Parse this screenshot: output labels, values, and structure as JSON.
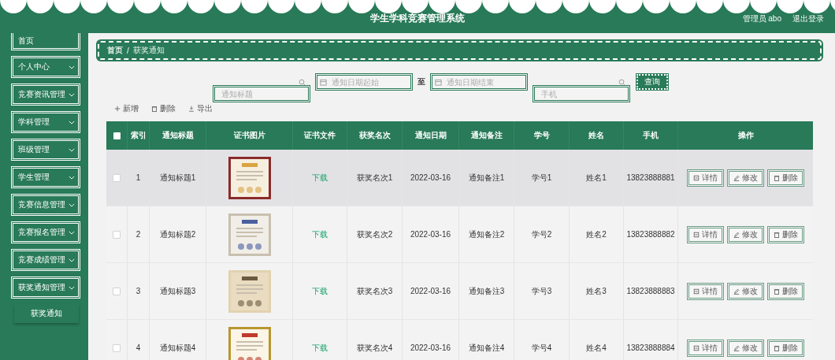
{
  "header": {
    "title": "学生学科竞赛管理系统",
    "user": "管理员 abo",
    "logout": "退出登录"
  },
  "sidebar": {
    "items": [
      {
        "label": "首页",
        "has_arrow": false
      },
      {
        "label": "个人中心",
        "has_arrow": true
      },
      {
        "label": "竞赛资讯管理",
        "has_arrow": true
      },
      {
        "label": "学科管理",
        "has_arrow": true
      },
      {
        "label": "班级管理",
        "has_arrow": true
      },
      {
        "label": "学生管理",
        "has_arrow": true
      },
      {
        "label": "竞赛信息管理",
        "has_arrow": true
      },
      {
        "label": "竞赛报名管理",
        "has_arrow": true
      },
      {
        "label": "竞赛成绩管理",
        "has_arrow": true
      },
      {
        "label": "获奖通知管理",
        "has_arrow": true,
        "children": [
          {
            "label": "获奖通知"
          }
        ]
      }
    ]
  },
  "breadcrumb": [
    "首页",
    "获奖通知"
  ],
  "breadcrumb_separator": "/",
  "search": {
    "fields": [
      {
        "kind": "search",
        "placeholder": "通知标题"
      },
      {
        "kind": "date",
        "placeholder": "通知日期起始"
      },
      {
        "kind": "separator",
        "text": "至"
      },
      {
        "kind": "date",
        "placeholder": "通知日期结束"
      },
      {
        "kind": "search",
        "placeholder": "手机"
      }
    ],
    "button": "查询"
  },
  "toolbar": [
    {
      "kind": "add",
      "label": "新增"
    },
    {
      "kind": "delete",
      "label": "删除"
    },
    {
      "kind": "export",
      "label": "导出"
    }
  ],
  "table": {
    "header_checked": false,
    "columns": [
      "索引",
      "通知标题",
      "证书图片",
      "证书文件",
      "获奖名次",
      "通知日期",
      "通知备注",
      "学号",
      "姓名",
      "手机",
      "操作"
    ],
    "rows": [
      {
        "checked": false,
        "hovered": true,
        "index": "1",
        "title": "通知标题1",
        "image": {
          "kind": "picture"
        },
        "file": "下载",
        "rank": "获奖名次1",
        "date": "2022-03-16",
        "note": "通知备注1",
        "student_no": "学号1",
        "name": "姓名1",
        "phone": "13823888881",
        "actions": [
          {
            "kind": "detail",
            "label": "详情"
          },
          {
            "kind": "edit",
            "label": "修改"
          },
          {
            "kind": "delete",
            "label": "删除"
          }
        ]
      },
      {
        "checked": false,
        "hovered": false,
        "index": "2",
        "title": "通知标题2",
        "image": {
          "kind": "picture"
        },
        "file": "下载",
        "rank": "获奖名次2",
        "date": "2022-03-16",
        "note": "通知备注2",
        "student_no": "学号2",
        "name": "姓名2",
        "phone": "13823888882",
        "actions": [
          {
            "kind": "detail",
            "label": "详情"
          },
          {
            "kind": "edit",
            "label": "修改"
          },
          {
            "kind": "delete",
            "label": "删除"
          }
        ]
      },
      {
        "checked": false,
        "hovered": false,
        "index": "3",
        "title": "通知标题3",
        "image": {
          "kind": "picture"
        },
        "file": "下载",
        "rank": "获奖名次3",
        "date": "2022-03-16",
        "note": "通知备注3",
        "student_no": "学号3",
        "name": "姓名3",
        "phone": "13823888883",
        "actions": [
          {
            "kind": "detail",
            "label": "详情"
          },
          {
            "kind": "edit",
            "label": "修改"
          },
          {
            "kind": "delete",
            "label": "删除"
          }
        ]
      },
      {
        "checked": false,
        "hovered": false,
        "index": "4",
        "title": "通知标题4",
        "image": {
          "kind": "picture"
        },
        "file": "下载",
        "rank": "获奖名次4",
        "date": "2022-03-16",
        "note": "通知备注4",
        "student_no": "学号4",
        "name": "姓名4",
        "phone": "13823888884",
        "actions": [
          {
            "kind": "detail",
            "label": "详情"
          },
          {
            "kind": "edit",
            "label": "修改"
          },
          {
            "kind": "delete",
            "label": "删除"
          }
        ]
      }
    ]
  }
}
